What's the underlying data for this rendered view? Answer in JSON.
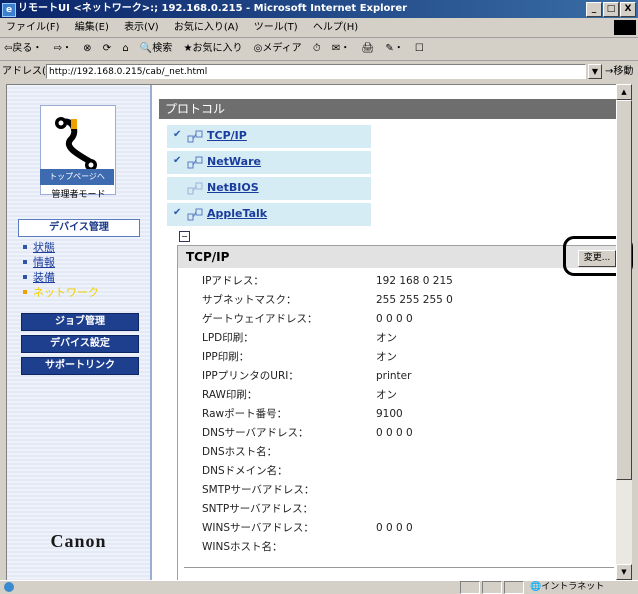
{
  "window": {
    "title": "リモートUI <ネットワーク>:; 192.168.0.215 - Microsoft Internet Explorer",
    "buttons": [
      "_",
      "□",
      "X"
    ]
  },
  "menubar": [
    "ファイル(F)",
    "編集(E)",
    "表示(V)",
    "お気に入り(A)",
    "ツール(T)",
    "ヘルプ(H)"
  ],
  "toolbar": [
    "⇦戻る・",
    "⇨・",
    "⊗",
    "⟳",
    "⌂",
    "🔍検索",
    "★お気に入り",
    "◎メディア",
    "⏱",
    "✉・",
    "🖨",
    "✎・",
    "☐"
  ],
  "address": {
    "label": "アドレス(D)",
    "url": "http://192.168.0.215/cab/_net.html",
    "go": "移動"
  },
  "sidebar": {
    "top_button": "トップページへ",
    "mode": "管理者モード",
    "menu_header": "デバイス管理",
    "links": [
      {
        "label": "状態",
        "current": false
      },
      {
        "label": "情報",
        "current": false
      },
      {
        "label": "装備",
        "current": false
      },
      {
        "label": "ネットワーク",
        "current": true
      }
    ],
    "buttons": [
      "ジョブ管理",
      "デバイス設定",
      "サポートリンク"
    ],
    "brand": "Canon"
  },
  "main": {
    "section_title": "プロトコル",
    "protocols": [
      {
        "label": "TCP/IP",
        "checked": true
      },
      {
        "label": "NetWare",
        "checked": true
      },
      {
        "label": "NetBIOS",
        "checked": false
      },
      {
        "label": "AppleTalk",
        "checked": true
      }
    ],
    "collapse_glyph": "−",
    "panel": {
      "title": "TCP/IP",
      "change_button": "変更...",
      "rows": [
        {
          "label": "IPアドレス：",
          "value": "192 168 0 215"
        },
        {
          "label": "サブネットマスク：",
          "value": "255 255 255 0"
        },
        {
          "label": "ゲートウェイアドレス：",
          "value": "0 0 0 0"
        },
        {
          "label": "LPD印刷：",
          "value": "オン"
        },
        {
          "label": "IPP印刷：",
          "value": "オン"
        },
        {
          "label": "IPPプリンタのURI：",
          "value": "printer"
        },
        {
          "label": "RAW印刷：",
          "value": "オン"
        },
        {
          "label": "Rawポート番号：",
          "value": "9100"
        },
        {
          "label": "DNSサーバアドレス：",
          "value": "0 0 0 0"
        },
        {
          "label": "DNSホスト名：",
          "value": ""
        },
        {
          "label": "DNSドメイン名：",
          "value": ""
        },
        {
          "label": "SMTPサーバアドレス：",
          "value": ""
        },
        {
          "label": "SNTPサーバアドレス：",
          "value": ""
        },
        {
          "label": "WINSサーバアドレス：",
          "value": "0 0 0 0"
        },
        {
          "label": "WINSホスト名：",
          "value": ""
        }
      ]
    }
  },
  "statusbar": {
    "zone": "イントラネット"
  },
  "colors": {
    "sidebar_button": "#1d3f8e",
    "link": "#1a3c9c",
    "protocol_bg": "#d5ecf4",
    "section_bar": "#6e6e6e"
  }
}
